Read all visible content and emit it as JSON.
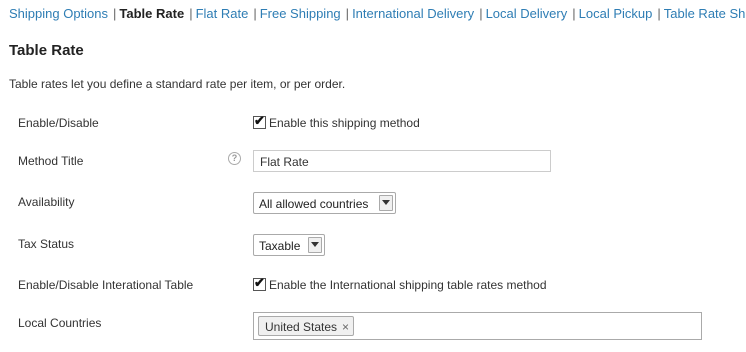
{
  "subnav": {
    "items": [
      {
        "label": "Shipping Options",
        "current": false
      },
      {
        "label": "Table Rate",
        "current": true
      },
      {
        "label": "Flat Rate",
        "current": false
      },
      {
        "label": "Free Shipping",
        "current": false
      },
      {
        "label": "International Delivery",
        "current": false
      },
      {
        "label": "Local Delivery",
        "current": false
      },
      {
        "label": "Local Pickup",
        "current": false
      },
      {
        "label": "Table Rate Shipping",
        "current": false
      }
    ],
    "separator": "|"
  },
  "section": {
    "title": "Table Rate",
    "description": "Table rates let you define a standard rate per item, or per order."
  },
  "rows": {
    "enable": {
      "label": "Enable/Disable",
      "checkbox_label": "Enable this shipping method",
      "checked": true
    },
    "method_title": {
      "label": "Method Title",
      "value": "Flat Rate",
      "help_icon": "question-circle-icon",
      "help_glyph": "?"
    },
    "availability": {
      "label": "Availability",
      "selected": "All allowed countries"
    },
    "tax_status": {
      "label": "Tax Status",
      "selected": "Taxable"
    },
    "international": {
      "label": "Enable/Disable Interational Table",
      "checkbox_label": "Enable the International shipping table rates method",
      "checked": true
    },
    "local_countries": {
      "label": "Local Countries",
      "tokens": [
        "United States"
      ],
      "remove_glyph": "×"
    }
  },
  "colors": {
    "link": "#2e7db4",
    "current_tab": "#222222",
    "border": "#aaaaaa"
  }
}
